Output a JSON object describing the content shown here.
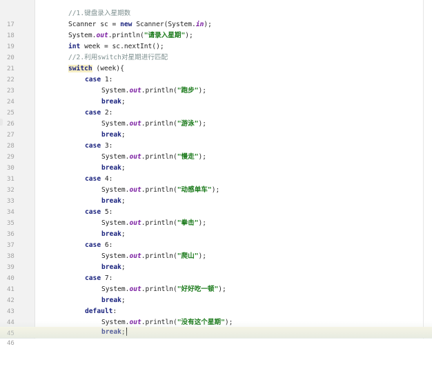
{
  "editor": {
    "lines": [
      {
        "n": "17",
        "comment": "//1.键盘录入星期数"
      },
      {
        "n": "18",
        "t1": "Scanner sc = ",
        "kw": "new",
        "t2": " Scanner(System.",
        "fld": "in",
        "t3": ");"
      },
      {
        "n": "19",
        "t1": "System.",
        "fld": "out",
        "t2": ".println(",
        "str": "\"请录入星期\"",
        "t3": ");"
      },
      {
        "n": "20",
        "kw": "int",
        "t1": " week = sc.nextInt();"
      },
      {
        "n": "21",
        "comment": "//2.利用switch对星期进行匹配"
      },
      {
        "n": "22",
        "kw": "switch",
        "t1": " (week){"
      },
      {
        "n": "23",
        "kw": "case",
        "t1": " 1:"
      },
      {
        "n": "24",
        "t1": "System.",
        "fld": "out",
        "t2": ".println(",
        "str": "\"跑步\"",
        "t3": ");"
      },
      {
        "n": "25",
        "kw": "break",
        "t1": ";"
      },
      {
        "n": "26",
        "kw": "case",
        "t1": " 2:"
      },
      {
        "n": "27",
        "t1": "System.",
        "fld": "out",
        "t2": ".println(",
        "str": "\"游泳\"",
        "t3": ");"
      },
      {
        "n": "28",
        "kw": "break",
        "t1": ";"
      },
      {
        "n": "29",
        "kw": "case",
        "t1": " 3:"
      },
      {
        "n": "30",
        "t1": "System.",
        "fld": "out",
        "t2": ".println(",
        "str": "\"慢走\"",
        "t3": ");"
      },
      {
        "n": "31",
        "kw": "break",
        "t1": ";"
      },
      {
        "n": "32",
        "kw": "case",
        "t1": " 4:"
      },
      {
        "n": "33",
        "t1": "System.",
        "fld": "out",
        "t2": ".println(",
        "str": "\"动感单车\"",
        "t3": ");"
      },
      {
        "n": "34",
        "kw": "break",
        "t1": ";"
      },
      {
        "n": "35",
        "kw": "case",
        "t1": " 5:"
      },
      {
        "n": "36",
        "t1": "System.",
        "fld": "out",
        "t2": ".println(",
        "str": "\"拳击\"",
        "t3": ");"
      },
      {
        "n": "37",
        "kw": "break",
        "t1": ";"
      },
      {
        "n": "38",
        "kw": "case",
        "t1": " 6:"
      },
      {
        "n": "39",
        "t1": "System.",
        "fld": "out",
        "t2": ".println(",
        "str": "\"爬山\"",
        "t3": ");"
      },
      {
        "n": "40",
        "kw": "break",
        "t1": ";"
      },
      {
        "n": "41",
        "kw": "case",
        "t1": " 7:"
      },
      {
        "n": "42",
        "t1": "System.",
        "fld": "out",
        "t2": ".println(",
        "str": "\"好好吃一顿\"",
        "t3": ");"
      },
      {
        "n": "43",
        "kw": "break",
        "t1": ";"
      },
      {
        "n": "44",
        "kw": "default",
        "t1": ":"
      },
      {
        "n": "45",
        "t1": "System.",
        "fld": "out",
        "t2": ".println(",
        "str": "\"没有这个星期\"",
        "t3": ");"
      },
      {
        "n": "46",
        "kw": "break",
        "t1": ";"
      }
    ]
  }
}
